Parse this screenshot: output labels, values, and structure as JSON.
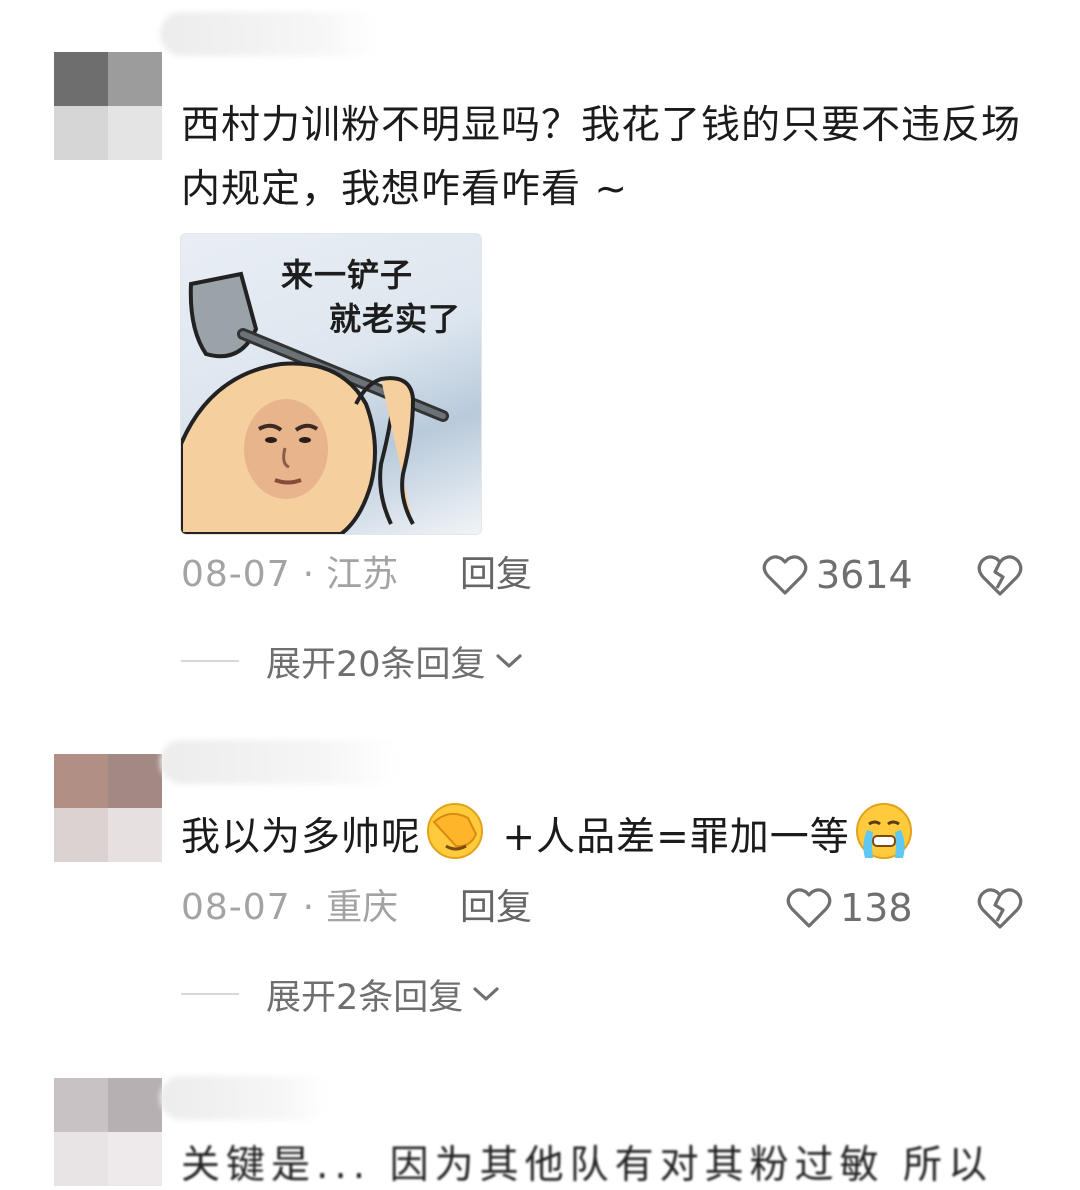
{
  "comments": [
    {
      "text": "西村力训粉不明显吗？我花了钱的只要不违反场内规定，我想咋看咋看 ~",
      "sticker": {
        "line1": "来一铲子",
        "line2": "就老实了"
      },
      "date": "08-07",
      "location": "江苏",
      "reply_label": "回复",
      "likes": "3614",
      "expand_label": "展开20条回复"
    },
    {
      "text_before": "我以为多帅呢",
      "emoji1": "face-with-hand-over-eyes-emoji",
      "text_middle": " +人品差=罪加一等",
      "emoji2": "crying-face-emoji",
      "date": "08-07",
      "location": "重庆",
      "reply_label": "回复",
      "likes": "138",
      "expand_label": "展开2条回复"
    },
    {
      "text_partial": "关键是...   因为其他队有对其粉过敏 所以"
    }
  ],
  "separator": "·",
  "colors": {
    "text": "#1b1b1b",
    "meta": "#a3a3a3",
    "secondary": "#6f6f6f"
  },
  "icons": [
    "heart-outline-icon",
    "broken-heart-icon",
    "chevron-down-icon"
  ]
}
